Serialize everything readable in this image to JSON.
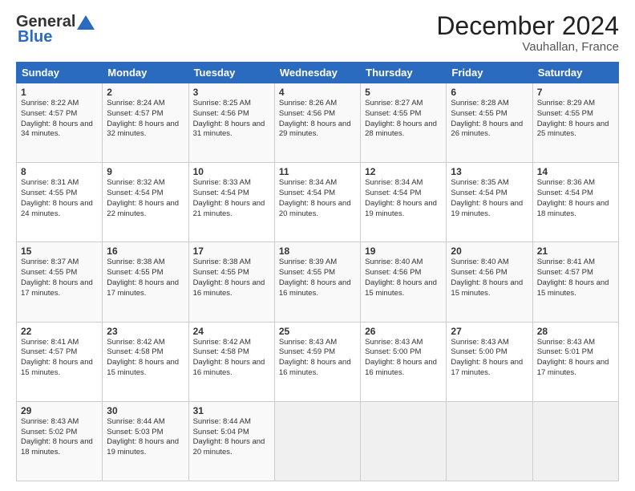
{
  "header": {
    "logo_line1": "General",
    "logo_line2": "Blue",
    "title": "December 2024",
    "subtitle": "Vauhallan, France"
  },
  "columns": [
    "Sunday",
    "Monday",
    "Tuesday",
    "Wednesday",
    "Thursday",
    "Friday",
    "Saturday"
  ],
  "weeks": [
    [
      {
        "day": "1",
        "sunrise": "Sunrise: 8:22 AM",
        "sunset": "Sunset: 4:57 PM",
        "daylight": "Daylight: 8 hours and 34 minutes."
      },
      {
        "day": "2",
        "sunrise": "Sunrise: 8:24 AM",
        "sunset": "Sunset: 4:57 PM",
        "daylight": "Daylight: 8 hours and 32 minutes."
      },
      {
        "day": "3",
        "sunrise": "Sunrise: 8:25 AM",
        "sunset": "Sunset: 4:56 PM",
        "daylight": "Daylight: 8 hours and 31 minutes."
      },
      {
        "day": "4",
        "sunrise": "Sunrise: 8:26 AM",
        "sunset": "Sunset: 4:56 PM",
        "daylight": "Daylight: 8 hours and 29 minutes."
      },
      {
        "day": "5",
        "sunrise": "Sunrise: 8:27 AM",
        "sunset": "Sunset: 4:55 PM",
        "daylight": "Daylight: 8 hours and 28 minutes."
      },
      {
        "day": "6",
        "sunrise": "Sunrise: 8:28 AM",
        "sunset": "Sunset: 4:55 PM",
        "daylight": "Daylight: 8 hours and 26 minutes."
      },
      {
        "day": "7",
        "sunrise": "Sunrise: 8:29 AM",
        "sunset": "Sunset: 4:55 PM",
        "daylight": "Daylight: 8 hours and 25 minutes."
      }
    ],
    [
      {
        "day": "8",
        "sunrise": "Sunrise: 8:31 AM",
        "sunset": "Sunset: 4:55 PM",
        "daylight": "Daylight: 8 hours and 24 minutes."
      },
      {
        "day": "9",
        "sunrise": "Sunrise: 8:32 AM",
        "sunset": "Sunset: 4:54 PM",
        "daylight": "Daylight: 8 hours and 22 minutes."
      },
      {
        "day": "10",
        "sunrise": "Sunrise: 8:33 AM",
        "sunset": "Sunset: 4:54 PM",
        "daylight": "Daylight: 8 hours and 21 minutes."
      },
      {
        "day": "11",
        "sunrise": "Sunrise: 8:34 AM",
        "sunset": "Sunset: 4:54 PM",
        "daylight": "Daylight: 8 hours and 20 minutes."
      },
      {
        "day": "12",
        "sunrise": "Sunrise: 8:34 AM",
        "sunset": "Sunset: 4:54 PM",
        "daylight": "Daylight: 8 hours and 19 minutes."
      },
      {
        "day": "13",
        "sunrise": "Sunrise: 8:35 AM",
        "sunset": "Sunset: 4:54 PM",
        "daylight": "Daylight: 8 hours and 19 minutes."
      },
      {
        "day": "14",
        "sunrise": "Sunrise: 8:36 AM",
        "sunset": "Sunset: 4:54 PM",
        "daylight": "Daylight: 8 hours and 18 minutes."
      }
    ],
    [
      {
        "day": "15",
        "sunrise": "Sunrise: 8:37 AM",
        "sunset": "Sunset: 4:55 PM",
        "daylight": "Daylight: 8 hours and 17 minutes."
      },
      {
        "day": "16",
        "sunrise": "Sunrise: 8:38 AM",
        "sunset": "Sunset: 4:55 PM",
        "daylight": "Daylight: 8 hours and 17 minutes."
      },
      {
        "day": "17",
        "sunrise": "Sunrise: 8:38 AM",
        "sunset": "Sunset: 4:55 PM",
        "daylight": "Daylight: 8 hours and 16 minutes."
      },
      {
        "day": "18",
        "sunrise": "Sunrise: 8:39 AM",
        "sunset": "Sunset: 4:55 PM",
        "daylight": "Daylight: 8 hours and 16 minutes."
      },
      {
        "day": "19",
        "sunrise": "Sunrise: 8:40 AM",
        "sunset": "Sunset: 4:56 PM",
        "daylight": "Daylight: 8 hours and 15 minutes."
      },
      {
        "day": "20",
        "sunrise": "Sunrise: 8:40 AM",
        "sunset": "Sunset: 4:56 PM",
        "daylight": "Daylight: 8 hours and 15 minutes."
      },
      {
        "day": "21",
        "sunrise": "Sunrise: 8:41 AM",
        "sunset": "Sunset: 4:57 PM",
        "daylight": "Daylight: 8 hours and 15 minutes."
      }
    ],
    [
      {
        "day": "22",
        "sunrise": "Sunrise: 8:41 AM",
        "sunset": "Sunset: 4:57 PM",
        "daylight": "Daylight: 8 hours and 15 minutes."
      },
      {
        "day": "23",
        "sunrise": "Sunrise: 8:42 AM",
        "sunset": "Sunset: 4:58 PM",
        "daylight": "Daylight: 8 hours and 15 minutes."
      },
      {
        "day": "24",
        "sunrise": "Sunrise: 8:42 AM",
        "sunset": "Sunset: 4:58 PM",
        "daylight": "Daylight: 8 hours and 16 minutes."
      },
      {
        "day": "25",
        "sunrise": "Sunrise: 8:43 AM",
        "sunset": "Sunset: 4:59 PM",
        "daylight": "Daylight: 8 hours and 16 minutes."
      },
      {
        "day": "26",
        "sunrise": "Sunrise: 8:43 AM",
        "sunset": "Sunset: 5:00 PM",
        "daylight": "Daylight: 8 hours and 16 minutes."
      },
      {
        "day": "27",
        "sunrise": "Sunrise: 8:43 AM",
        "sunset": "Sunset: 5:00 PM",
        "daylight": "Daylight: 8 hours and 17 minutes."
      },
      {
        "day": "28",
        "sunrise": "Sunrise: 8:43 AM",
        "sunset": "Sunset: 5:01 PM",
        "daylight": "Daylight: 8 hours and 17 minutes."
      }
    ],
    [
      {
        "day": "29",
        "sunrise": "Sunrise: 8:43 AM",
        "sunset": "Sunset: 5:02 PM",
        "daylight": "Daylight: 8 hours and 18 minutes."
      },
      {
        "day": "30",
        "sunrise": "Sunrise: 8:44 AM",
        "sunset": "Sunset: 5:03 PM",
        "daylight": "Daylight: 8 hours and 19 minutes."
      },
      {
        "day": "31",
        "sunrise": "Sunrise: 8:44 AM",
        "sunset": "Sunset: 5:04 PM",
        "daylight": "Daylight: 8 hours and 20 minutes."
      },
      null,
      null,
      null,
      null
    ]
  ]
}
